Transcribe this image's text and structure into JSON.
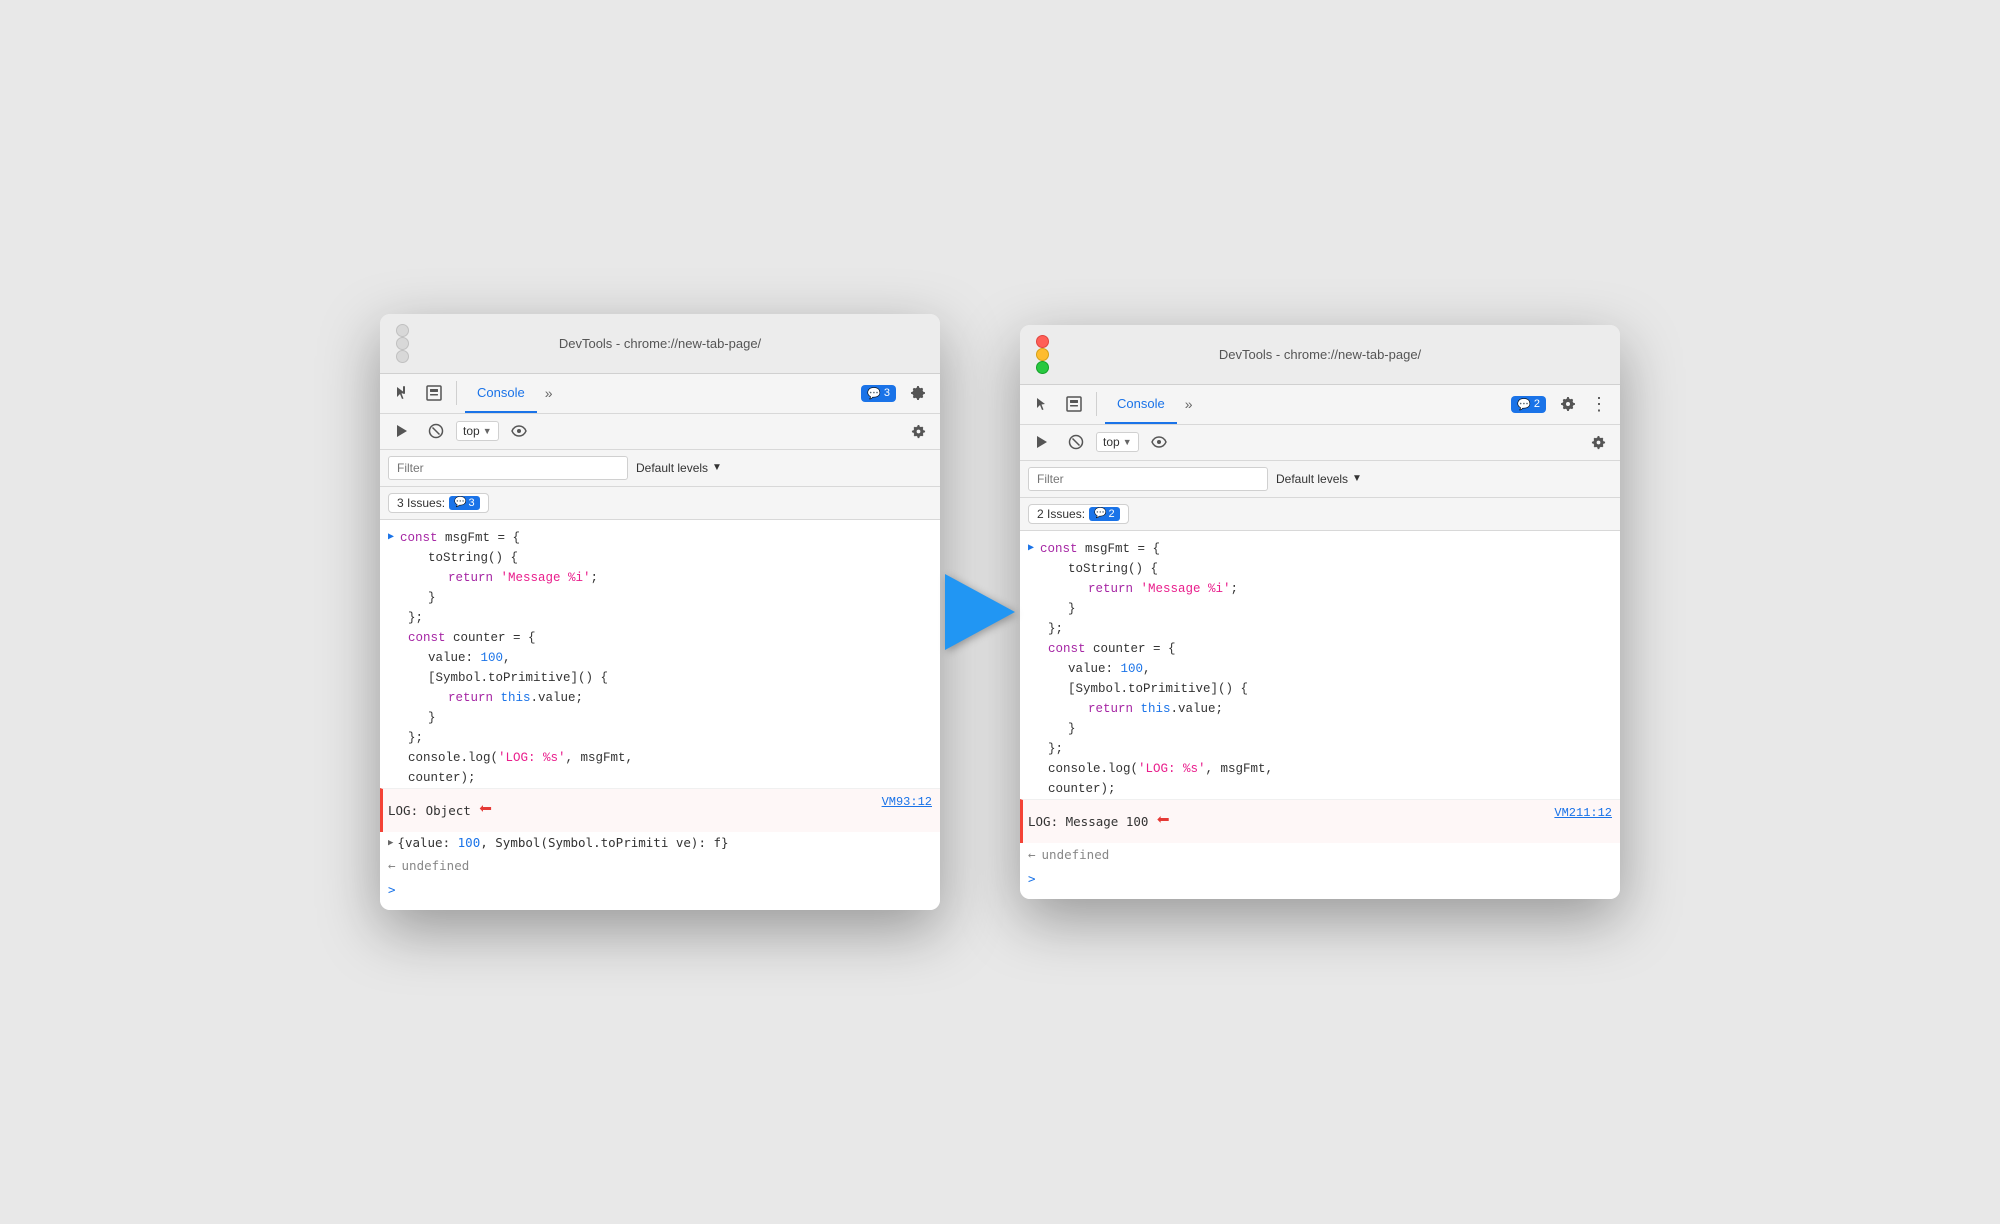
{
  "left_window": {
    "title": "DevTools - chrome://new-tab-page/",
    "tab_label": "Console",
    "more_tabs": "»",
    "badge_count": "3",
    "badge_icon": "💬",
    "filter_placeholder": "Filter",
    "default_levels": "Default levels",
    "top_label": "top",
    "issues_label": "3 Issues:",
    "issues_count": "3",
    "code": [
      {
        "indent": 0,
        "parts": [
          {
            "text": "const ",
            "cls": "kw-purple"
          },
          {
            "text": "msgFmt = {",
            "cls": "plain"
          }
        ]
      },
      {
        "indent": 1,
        "parts": [
          {
            "text": "toString() {",
            "cls": "plain"
          }
        ]
      },
      {
        "indent": 2,
        "parts": [
          {
            "text": "return ",
            "cls": "kw-purple"
          },
          {
            "text": "'Message %i'",
            "cls": "str-pink"
          },
          {
            "text": ";",
            "cls": "plain"
          }
        ]
      },
      {
        "indent": 1,
        "parts": [
          {
            "text": "}",
            "cls": "plain"
          }
        ]
      },
      {
        "indent": 0,
        "parts": [
          {
            "text": "};",
            "cls": "plain"
          }
        ]
      },
      {
        "indent": 0,
        "parts": [
          {
            "text": "const ",
            "cls": "kw-purple"
          },
          {
            "text": "counter = {",
            "cls": "plain"
          }
        ]
      },
      {
        "indent": 1,
        "parts": [
          {
            "text": "value: ",
            "cls": "plain"
          },
          {
            "text": "100",
            "cls": "num-blue"
          },
          {
            "text": ",",
            "cls": "plain"
          }
        ]
      },
      {
        "indent": 1,
        "parts": [
          {
            "text": "[Symbol.toPrimitive]() {",
            "cls": "plain"
          }
        ]
      },
      {
        "indent": 2,
        "parts": [
          {
            "text": "return ",
            "cls": "kw-purple"
          },
          {
            "text": "this",
            "cls": "kw-blue"
          },
          {
            "text": ".value;",
            "cls": "plain"
          }
        ]
      },
      {
        "indent": 1,
        "parts": [
          {
            "text": "}",
            "cls": "plain"
          }
        ]
      },
      {
        "indent": 0,
        "parts": [
          {
            "text": "};",
            "cls": "plain"
          }
        ]
      },
      {
        "indent": 0,
        "parts": [
          {
            "text": "console.log(",
            "cls": "plain"
          },
          {
            "text": "'LOG: %s'",
            "cls": "str-pink"
          },
          {
            "text": ", msgFmt,",
            "cls": "plain"
          }
        ]
      },
      {
        "indent": 0,
        "parts": [
          {
            "text": "counter);",
            "cls": "plain"
          }
        ]
      }
    ],
    "log_output": "LOG: Object",
    "vm_ref": "VM93:12",
    "obj_detail": "{value: 100, Symbol(Symbol.toPrimiti ve): f}",
    "undefined_text": "undefined",
    "prompt_text": ">"
  },
  "right_window": {
    "title": "DevTools - chrome://new-tab-page/",
    "tab_label": "Console",
    "more_tabs": "»",
    "badge_count": "2",
    "badge_icon": "💬",
    "filter_placeholder": "Filter",
    "default_levels": "Default levels",
    "top_label": "top",
    "issues_label": "2 Issues:",
    "issues_count": "2",
    "code": [
      {
        "indent": 0,
        "parts": [
          {
            "text": "const ",
            "cls": "kw-purple"
          },
          {
            "text": "msgFmt = {",
            "cls": "plain"
          }
        ]
      },
      {
        "indent": 1,
        "parts": [
          {
            "text": "toString() {",
            "cls": "plain"
          }
        ]
      },
      {
        "indent": 2,
        "parts": [
          {
            "text": "return ",
            "cls": "kw-purple"
          },
          {
            "text": "'Message %i'",
            "cls": "str-pink"
          },
          {
            "text": ";",
            "cls": "plain"
          }
        ]
      },
      {
        "indent": 1,
        "parts": [
          {
            "text": "}",
            "cls": "plain"
          }
        ]
      },
      {
        "indent": 0,
        "parts": [
          {
            "text": "};",
            "cls": "plain"
          }
        ]
      },
      {
        "indent": 0,
        "parts": [
          {
            "text": "const ",
            "cls": "kw-purple"
          },
          {
            "text": "counter = {",
            "cls": "plain"
          }
        ]
      },
      {
        "indent": 1,
        "parts": [
          {
            "text": "value: ",
            "cls": "plain"
          },
          {
            "text": "100",
            "cls": "num-blue"
          },
          {
            "text": ",",
            "cls": "plain"
          }
        ]
      },
      {
        "indent": 1,
        "parts": [
          {
            "text": "[Symbol.toPrimitive]() {",
            "cls": "plain"
          }
        ]
      },
      {
        "indent": 2,
        "parts": [
          {
            "text": "return ",
            "cls": "kw-purple"
          },
          {
            "text": "this",
            "cls": "kw-blue"
          },
          {
            "text": ".value;",
            "cls": "plain"
          }
        ]
      },
      {
        "indent": 1,
        "parts": [
          {
            "text": "}",
            "cls": "plain"
          }
        ]
      },
      {
        "indent": 0,
        "parts": [
          {
            "text": "};",
            "cls": "plain"
          }
        ]
      },
      {
        "indent": 0,
        "parts": [
          {
            "text": "console.log(",
            "cls": "plain"
          },
          {
            "text": "'LOG: %s'",
            "cls": "str-pink"
          },
          {
            "text": ", msgFmt,",
            "cls": "plain"
          }
        ]
      },
      {
        "indent": 0,
        "parts": [
          {
            "text": "counter);",
            "cls": "plain"
          }
        ]
      }
    ],
    "log_output": "LOG: Message 100",
    "vm_ref": "VM211:12",
    "undefined_text": "undefined",
    "prompt_text": ">"
  },
  "arrow": {
    "direction": "right",
    "color": "#2196F3"
  }
}
